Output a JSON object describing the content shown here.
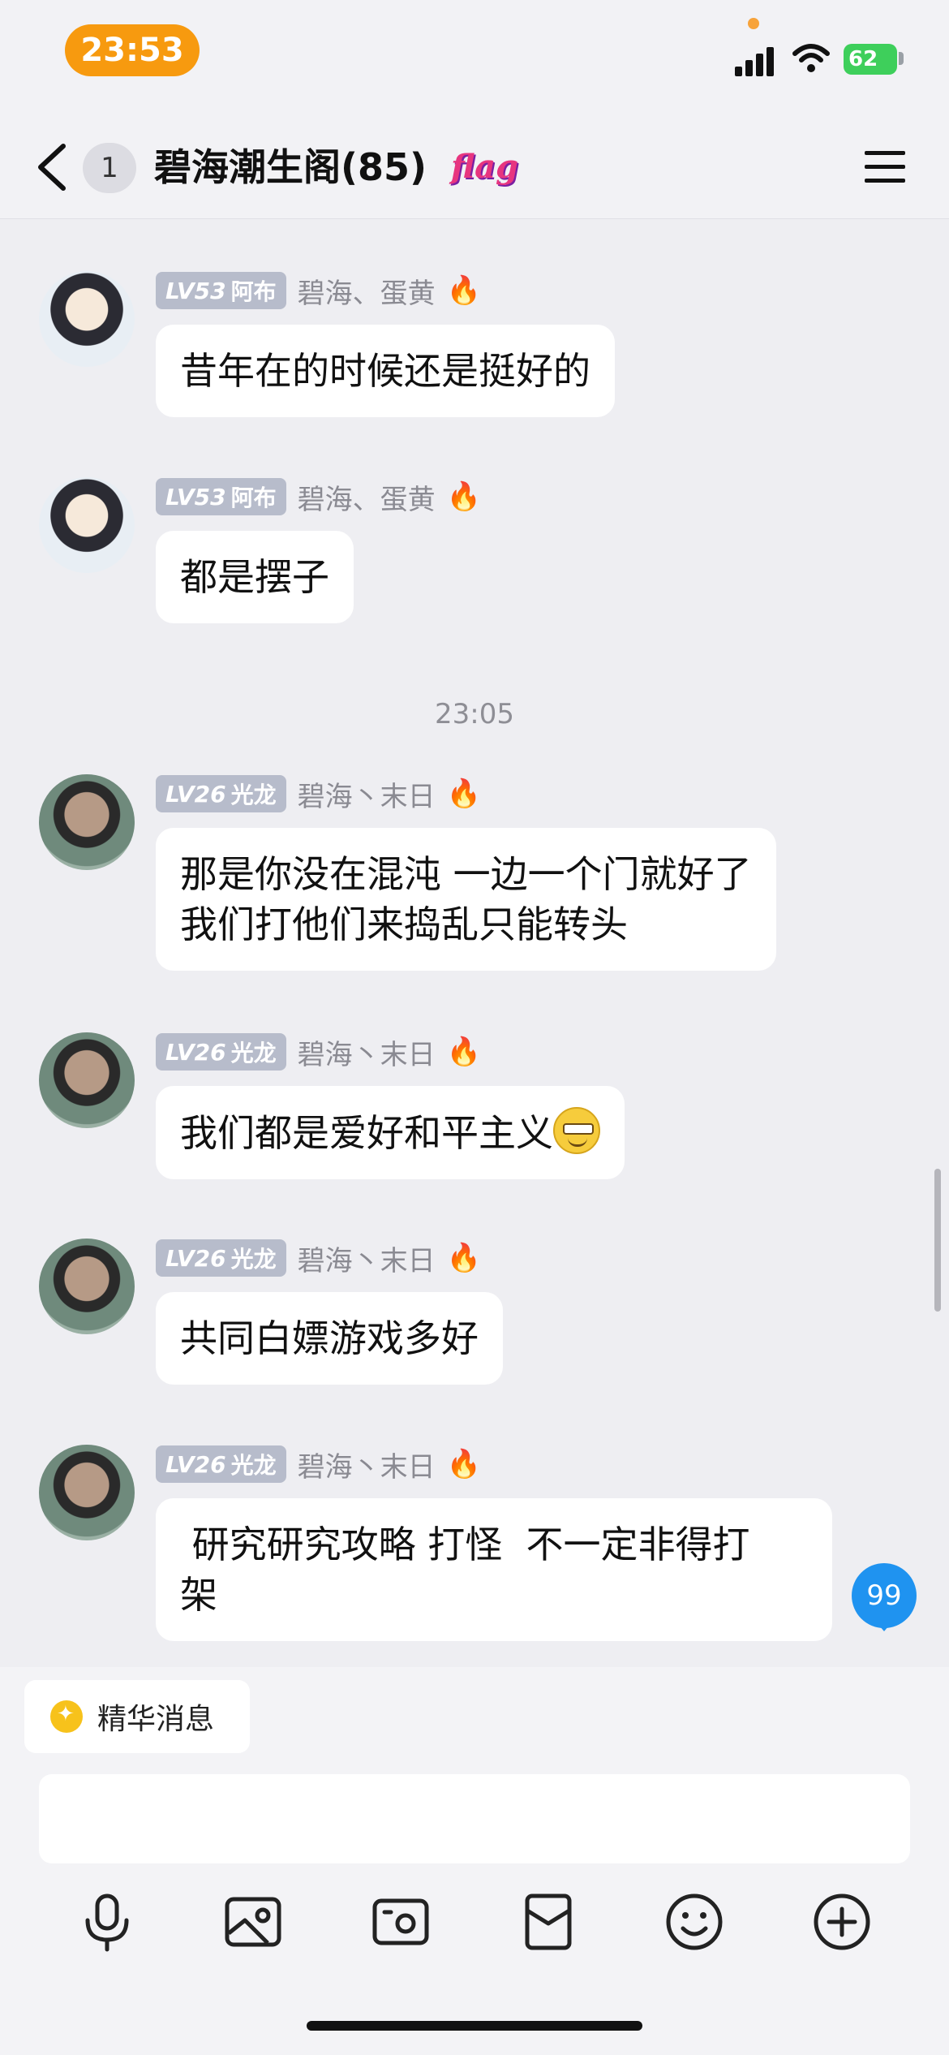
{
  "status_bar": {
    "time": "23:53",
    "battery": "62"
  },
  "header": {
    "unread_count": "1",
    "group_title": "碧海潮生阁(85)",
    "flag_badge": "flag"
  },
  "messages": [
    {
      "avatar": "abu-avatar",
      "level": "LV",
      "level_num": "53",
      "level_name": "阿布",
      "group_tag": "碧海、蛋黄",
      "text": "昔年在的时候还是挺好的"
    },
    {
      "avatar": "abu-avatar",
      "level": "LV",
      "level_num": "53",
      "level_name": "阿布",
      "group_tag": "碧海、蛋黄",
      "text": "都是摆子"
    },
    {
      "avatar": "guanglong-avatar",
      "level": "LV",
      "level_num": "26",
      "level_name": "光龙",
      "group_tag": "碧海丶末日",
      "text": "那是你没在混沌 一边一个门就好了\n我们打他们来捣乱只能转头"
    },
    {
      "avatar": "guanglong-avatar",
      "level": "LV",
      "level_num": "26",
      "level_name": "光龙",
      "group_tag": "碧海丶末日",
      "text": "我们都是爱好和平主义"
    },
    {
      "avatar": "guanglong-avatar",
      "level": "LV",
      "level_num": "26",
      "level_name": "光龙",
      "group_tag": "碧海丶末日",
      "text": "共同白嫖游戏多好"
    },
    {
      "avatar": "guanglong-avatar",
      "level": "LV",
      "level_num": "26",
      "level_name": "光龙",
      "group_tag": "碧海丶末日",
      "text": " 研究研究攻略 打怪  不一定非得打\n架"
    }
  ],
  "timestamp": "23:05",
  "new_message_count": "99",
  "bottom": {
    "essence_label": "精华消息",
    "input_value": ""
  },
  "toolbar": [
    "voice-icon",
    "image-icon",
    "camera-icon",
    "red-packet-icon",
    "emoji-icon",
    "plus-icon"
  ],
  "colors": {
    "status_pill": "#f79a0f",
    "new_count": "#1f93f0",
    "fire": "#f4632a",
    "level_badge": "#b7bccb"
  }
}
